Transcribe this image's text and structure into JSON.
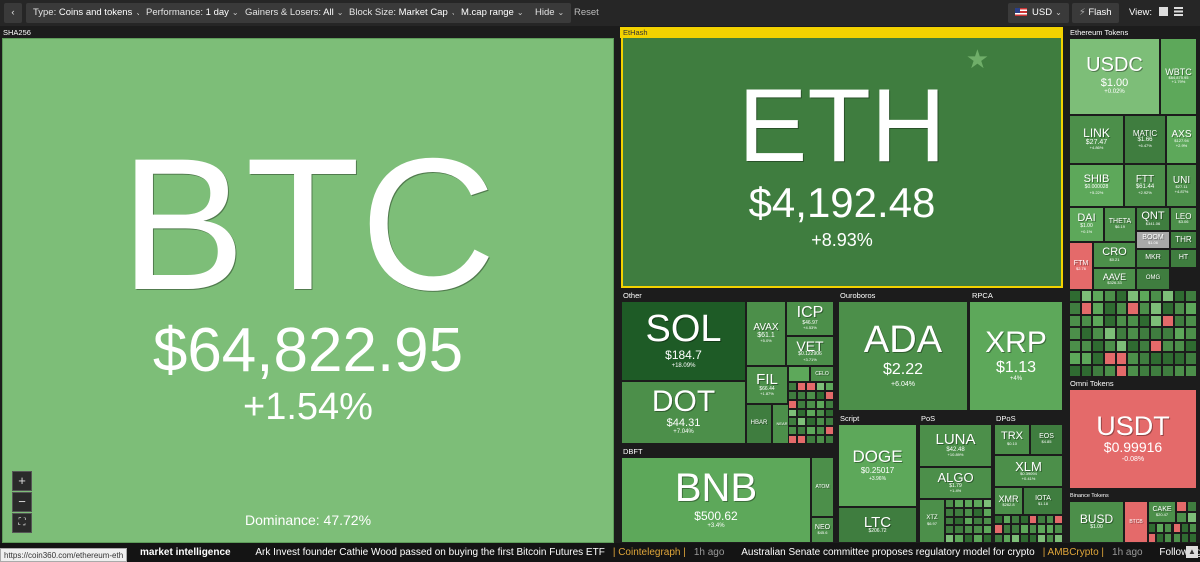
{
  "toolbar": {
    "back": "‹",
    "type_label": "Type:",
    "type_value": "Coins and tokens",
    "performance_label": "Performance:",
    "performance_value": "1 day",
    "gainers_label": "Gainers & Losers:",
    "gainers_value": "All",
    "blocksize_label": "Block Size:",
    "blocksize_value": "Market Cap",
    "mcap": "M.cap range",
    "hide": "Hide",
    "reset": "Reset",
    "currency": "USD",
    "flash": "Flash",
    "view": "View:",
    "caret": "⌄"
  },
  "groups": {
    "sha256": "SHA256",
    "ethash": "EtHash",
    "eth_tokens": "Ethereum Tokens",
    "other": "Other",
    "ouroboros": "Ouroboros",
    "rpca": "RPCA",
    "dbft": "DBFT",
    "script": "Script",
    "pos": "PoS",
    "dpos": "DPoS",
    "omni": "Omni Tokens",
    "binance": "Binance Tokens"
  },
  "tiles": {
    "btc": {
      "sym": "BTC",
      "price": "$64,822.95",
      "chg": "+1.54%",
      "dominance": "Dominance: 47.72%"
    },
    "eth": {
      "sym": "ETH",
      "price": "$4,192.48",
      "chg": "+8.93%"
    },
    "usdc": {
      "sym": "USDC",
      "price": "$1.00",
      "chg": "+0.02%"
    },
    "wbtc": {
      "sym": "WBTC",
      "price": "$64,875.95",
      "chg": "+1.79%"
    },
    "link": {
      "sym": "LINK",
      "price": "$27.47",
      "chg": "+4.86%"
    },
    "matic": {
      "sym": "MATIC",
      "price": "$1.66",
      "chg": "+6.47%"
    },
    "axs": {
      "sym": "AXS",
      "price": "$127.94",
      "chg": "+2.9%"
    },
    "shib": {
      "sym": "SHIB",
      "price": "$0.000028",
      "chg": "+5.22%"
    },
    "ftt": {
      "sym": "FTT",
      "price": "$61.44",
      "chg": "+2.92%"
    },
    "uni": {
      "sym": "UNI",
      "price": "$27.11",
      "chg": "+4.87%"
    },
    "dai": {
      "sym": "DAI",
      "price": "$1.00",
      "chg": "+0.1%"
    },
    "theta": {
      "sym": "THETA",
      "price": "$6.19",
      "chg": ""
    },
    "qnt": {
      "sym": "QNT",
      "price": "$341.06",
      "chg": ""
    },
    "leo": {
      "sym": "LEO",
      "price": "$3.06",
      "chg": ""
    },
    "boom": {
      "sym": "BOOM",
      "price": "$1.06",
      "chg": ""
    },
    "thr": {
      "sym": "THR",
      "price": "",
      "chg": ""
    },
    "ftm": {
      "sym": "FTM",
      "price": "$2.76",
      "chg": ""
    },
    "cro": {
      "sym": "CRO",
      "price": "$0.21",
      "chg": ""
    },
    "mkr": {
      "sym": "MKR",
      "price": "",
      "chg": ""
    },
    "ht": {
      "sym": "HT",
      "price": "",
      "chg": ""
    },
    "aave": {
      "sym": "AAVE",
      "price": "$326.33",
      "chg": ""
    },
    "omg": {
      "sym": "OMG",
      "price": "",
      "chg": ""
    },
    "sol": {
      "sym": "SOL",
      "price": "$184.7",
      "chg": "+18.09%"
    },
    "avax": {
      "sym": "AVAX",
      "price": "$61.1",
      "chg": "+5.0%"
    },
    "icp": {
      "sym": "ICP",
      "price": "$46.97",
      "chg": "+4.53%"
    },
    "vet": {
      "sym": "VET",
      "price": "$0.122906",
      "chg": "+3.71%"
    },
    "fil": {
      "sym": "FIL",
      "price": "$66.44",
      "chg": "+1.87%"
    },
    "dot": {
      "sym": "DOT",
      "price": "$44.31",
      "chg": "+7.04%"
    },
    "celo": {
      "sym": "CELO",
      "price": "",
      "chg": ""
    },
    "hbar": {
      "sym": "HBAR",
      "price": "",
      "chg": ""
    },
    "xtz_o": {
      "sym": "NEAR",
      "price": "",
      "chg": ""
    },
    "ada": {
      "sym": "ADA",
      "price": "$2.22",
      "chg": "+6.04%"
    },
    "xrp": {
      "sym": "XRP",
      "price": "$1.13",
      "chg": "+4%"
    },
    "bnb": {
      "sym": "BNB",
      "price": "$500.62",
      "chg": "+3.4%"
    },
    "atom": {
      "sym": "ATOM",
      "price": "",
      "chg": ""
    },
    "neo": {
      "sym": "NEO",
      "price": "$45.6",
      "chg": ""
    },
    "doge": {
      "sym": "DOGE",
      "price": "$0.25017",
      "chg": "+3.96%"
    },
    "ltc": {
      "sym": "LTC",
      "price": "$206.72",
      "chg": ""
    },
    "luna": {
      "sym": "LUNA",
      "price": "$42.48",
      "chg": "+10.89%"
    },
    "algo": {
      "sym": "ALGO",
      "price": "$1.79",
      "chg": "+1.4%"
    },
    "xtz": {
      "sym": "XTZ",
      "price": "$6.97",
      "chg": ""
    },
    "trx": {
      "sym": "TRX",
      "price": "$0.10",
      "chg": ""
    },
    "eos": {
      "sym": "EOS",
      "price": "$4.85",
      "chg": ""
    },
    "xlm": {
      "sym": "XLM",
      "price": "$0.39094",
      "chg": "+0.41%"
    },
    "xmr": {
      "sym": "XMR",
      "price": "$262.8",
      "chg": ""
    },
    "iota": {
      "sym": "IOTA",
      "price": "$1.18",
      "chg": ""
    },
    "usdt": {
      "sym": "USDT",
      "price": "$0.99916",
      "chg": "-0.08%"
    },
    "busd": {
      "sym": "BUSD",
      "price": "$1.00",
      "chg": ""
    },
    "cake": {
      "sym": "CAKE",
      "price": "$20.47",
      "chg": ""
    },
    "btcb": {
      "sym": "BTCB",
      "price": "",
      "chg": ""
    }
  },
  "zoom": {
    "plus": "+",
    "minus": "−",
    "fit": "⛶"
  },
  "ticker": {
    "lead": "market intelligence",
    "news1": "Ark Invest founder Cathie Wood passed on buying the first Bitcoin Futures ETF",
    "src1": "| Cointelegraph |",
    "time1": "1h ago",
    "news2": "Australian Senate committee proposes regulatory model for crypto",
    "src2": "| AMBCrypto |",
    "time2": "1h ago",
    "news3": "Following E"
  },
  "status_url": "https://coin360.com/ethereum-eth"
}
